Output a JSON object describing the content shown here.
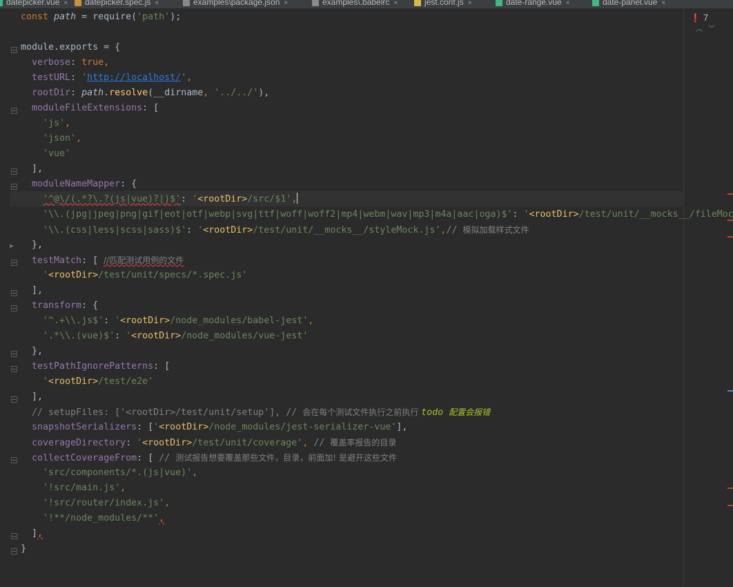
{
  "tabs": [
    {
      "label": "datepicker.vue",
      "icon": "vue-file-icon",
      "icon_color": "#41b883"
    },
    {
      "label": "datepicker.spec.js",
      "icon": "js-test-file-icon",
      "icon_color": "#c9913a"
    },
    {
      "label": "examples\\package.json",
      "icon": "json-file-icon",
      "icon_color": "#8a8a8a"
    },
    {
      "label": "examples\\.babelrc",
      "icon": "config-file-icon",
      "icon_color": "#8a8a8a"
    },
    {
      "label": "jest.conf.js",
      "icon": "js-file-icon",
      "icon_color": "#d8b74b"
    },
    {
      "label": "date-range.vue",
      "icon": "vue-file-icon",
      "icon_color": "#41b883"
    },
    {
      "label": "date-panel.vue",
      "icon": "vue-file-icon",
      "icon_color": "#41b883"
    }
  ],
  "inspection": {
    "error_count": "7"
  },
  "colors": {
    "background": "#2b2b2b",
    "keyword": "#cc7832",
    "property": "#9876aa",
    "string": "#6a8759",
    "tag": "#e8bf6a",
    "comment": "#808080",
    "todo": "#a8c023",
    "link": "#287bde"
  },
  "code_lines": [
    [
      {
        "t": "const ",
        "c": "kw"
      },
      {
        "t": "path",
        "c": "var"
      },
      {
        "t": " = require(",
        "c": ""
      },
      {
        "t": "'path'",
        "c": "str"
      },
      {
        "t": ");",
        "c": ""
      }
    ],
    [],
    [
      {
        "t": "module.exports = {",
        "c": ""
      }
    ],
    [
      {
        "t": "  ",
        "c": ""
      },
      {
        "t": "verbose",
        "c": "prop"
      },
      {
        "t": ": ",
        "c": ""
      },
      {
        "t": "true",
        "c": "kw"
      },
      {
        "t": ",",
        "c": "kw"
      }
    ],
    [
      {
        "t": "  ",
        "c": ""
      },
      {
        "t": "testURL",
        "c": "prop"
      },
      {
        "t": ": ",
        "c": ""
      },
      {
        "t": "'",
        "c": "str"
      },
      {
        "t": "http://localhost/",
        "c": "url"
      },
      {
        "t": "'",
        "c": "str"
      },
      {
        "t": ",",
        "c": "kw"
      }
    ],
    [
      {
        "t": "  ",
        "c": ""
      },
      {
        "t": "rootDir",
        "c": "prop"
      },
      {
        "t": ": ",
        "c": ""
      },
      {
        "t": "path",
        "c": "var"
      },
      {
        "t": ".",
        "c": ""
      },
      {
        "t": "resolve",
        "c": "fn"
      },
      {
        "t": "(__dirname",
        "c": ""
      },
      {
        "t": ", ",
        "c": "kw"
      },
      {
        "t": "'../../'",
        "c": "str"
      },
      {
        "t": "),",
        "c": ""
      }
    ],
    [
      {
        "t": "  ",
        "c": ""
      },
      {
        "t": "moduleFileExtensions",
        "c": "prop"
      },
      {
        "t": ": [",
        "c": ""
      }
    ],
    [
      {
        "t": "    ",
        "c": ""
      },
      {
        "t": "'js'",
        "c": "str"
      },
      {
        "t": ",",
        "c": "kw"
      }
    ],
    [
      {
        "t": "    ",
        "c": ""
      },
      {
        "t": "'json'",
        "c": "str"
      },
      {
        "t": ",",
        "c": "kw"
      }
    ],
    [
      {
        "t": "    ",
        "c": ""
      },
      {
        "t": "'vue'",
        "c": "str"
      }
    ],
    [
      {
        "t": "  ],",
        "c": ""
      }
    ],
    [
      {
        "t": "  ",
        "c": ""
      },
      {
        "t": "moduleNameMapper",
        "c": "prop"
      },
      {
        "t": ": {",
        "c": ""
      }
    ],
    [
      {
        "t": "    ",
        "c": ""
      },
      {
        "t": "'^@\\/(.*?\\.?(js|vue)?|)$'",
        "c": "str uline"
      },
      {
        "t": ": ",
        "c": ""
      },
      {
        "t": "'",
        "c": "str"
      },
      {
        "t": "<rootDir>",
        "c": "tag"
      },
      {
        "t": "/src/$1'",
        "c": "str"
      },
      {
        "t": ",",
        "c": "kw"
      }
    ],
    [
      {
        "t": "    ",
        "c": ""
      },
      {
        "t": "'\\\\.(jpg|jpeg|png|gif|eot|otf|webp|svg|ttf|woff|woff2|mp4|webm|wav|mp3|m4a|aac|oga)$'",
        "c": "str"
      },
      {
        "t": ": ",
        "c": ""
      },
      {
        "t": "'",
        "c": "str"
      },
      {
        "t": "<rootDir>",
        "c": "tag"
      },
      {
        "t": "/test/unit/__mocks__/fileMock.js'",
        "c": "str"
      }
    ],
    [
      {
        "t": "    ",
        "c": ""
      },
      {
        "t": "'\\\\.(css|less|scss|sass)$'",
        "c": "str"
      },
      {
        "t": ": ",
        "c": ""
      },
      {
        "t": "'",
        "c": "str"
      },
      {
        "t": "<rootDir>",
        "c": "tag"
      },
      {
        "t": "/test/unit/__mocks__/styleMock.js'",
        "c": "str"
      },
      {
        "t": ",",
        "c": "kw"
      },
      {
        "t": "// ",
        "c": "cmt"
      },
      {
        "t": "模拟加载样式文件",
        "c": "cmt cn"
      }
    ],
    [
      {
        "t": "  },",
        "c": ""
      }
    ],
    [
      {
        "t": "  ",
        "c": ""
      },
      {
        "t": "testMatch",
        "c": "prop"
      },
      {
        "t": ": [ ",
        "c": ""
      },
      {
        "t": "//匹配测试用例的文件",
        "c": "cmt cn uline"
      }
    ],
    [
      {
        "t": "    ",
        "c": ""
      },
      {
        "t": "'",
        "c": "str"
      },
      {
        "t": "<rootDir>",
        "c": "tag"
      },
      {
        "t": "/test/unit/specs/*.spec.js'",
        "c": "str"
      }
    ],
    [
      {
        "t": "  ],",
        "c": ""
      }
    ],
    [
      {
        "t": "  ",
        "c": ""
      },
      {
        "t": "transform",
        "c": "prop"
      },
      {
        "t": ": {",
        "c": ""
      }
    ],
    [
      {
        "t": "    ",
        "c": ""
      },
      {
        "t": "'^.+\\\\.js$'",
        "c": "str"
      },
      {
        "t": ": ",
        "c": ""
      },
      {
        "t": "'",
        "c": "str"
      },
      {
        "t": "<rootDir>",
        "c": "tag"
      },
      {
        "t": "/node_modules/babel-jest'",
        "c": "str"
      },
      {
        "t": ",",
        "c": "kw"
      }
    ],
    [
      {
        "t": "    ",
        "c": ""
      },
      {
        "t": "'.*\\\\.(vue)$'",
        "c": "str"
      },
      {
        "t": ": ",
        "c": ""
      },
      {
        "t": "'",
        "c": "str"
      },
      {
        "t": "<rootDir>",
        "c": "tag"
      },
      {
        "t": "/node_modules/vue-jest'",
        "c": "str"
      }
    ],
    [
      {
        "t": "  },",
        "c": ""
      }
    ],
    [
      {
        "t": "  ",
        "c": ""
      },
      {
        "t": "testPathIgnorePatterns",
        "c": "prop"
      },
      {
        "t": ": [",
        "c": ""
      }
    ],
    [
      {
        "t": "    ",
        "c": ""
      },
      {
        "t": "'",
        "c": "str"
      },
      {
        "t": "<rootDir>",
        "c": "tag"
      },
      {
        "t": "/test/e2e'",
        "c": "str"
      }
    ],
    [
      {
        "t": "  ],",
        "c": ""
      }
    ],
    [
      {
        "t": "  // setupFiles: ['<rootDir>/test/unit/setup'], // ",
        "c": "cmt"
      },
      {
        "t": "会在每个测试文件执行之前执行 ",
        "c": "cmt cn"
      },
      {
        "t": "todo ",
        "c": "todo"
      },
      {
        "t": "配置会报错",
        "c": "todo cn"
      }
    ],
    [
      {
        "t": "  ",
        "c": ""
      },
      {
        "t": "snapshotSerializers",
        "c": "prop"
      },
      {
        "t": ": [",
        "c": ""
      },
      {
        "t": "'",
        "c": "str"
      },
      {
        "t": "<rootDir>",
        "c": "tag"
      },
      {
        "t": "/node_modules/jest-serializer-vue'",
        "c": "str"
      },
      {
        "t": "],",
        "c": ""
      }
    ],
    [
      {
        "t": "  ",
        "c": ""
      },
      {
        "t": "coverageDirectory",
        "c": "prop"
      },
      {
        "t": ": ",
        "c": ""
      },
      {
        "t": "'",
        "c": "str"
      },
      {
        "t": "<rootDir>",
        "c": "tag"
      },
      {
        "t": "/test/unit/coverage'",
        "c": "str"
      },
      {
        "t": ", ",
        "c": "kw"
      },
      {
        "t": "// ",
        "c": "cmt"
      },
      {
        "t": "覆盖率报告的目录",
        "c": "cmt cn"
      }
    ],
    [
      {
        "t": "  ",
        "c": ""
      },
      {
        "t": "collectCoverageFrom",
        "c": "prop"
      },
      {
        "t": ": [ ",
        "c": ""
      },
      {
        "t": "// ",
        "c": "cmt"
      },
      {
        "t": "测试报告想要覆盖那些文件，目录，前面加! 是避开这些文件",
        "c": "cmt cn"
      }
    ],
    [
      {
        "t": "    ",
        "c": ""
      },
      {
        "t": "'src/components/*.(js|vue)'",
        "c": "str"
      },
      {
        "t": ",",
        "c": "kw"
      }
    ],
    [
      {
        "t": "    ",
        "c": ""
      },
      {
        "t": "'!src/main.js'",
        "c": "str"
      },
      {
        "t": ",",
        "c": "kw"
      }
    ],
    [
      {
        "t": "    ",
        "c": ""
      },
      {
        "t": "'!src/router/index.js'",
        "c": "str"
      },
      {
        "t": ",",
        "c": "kw"
      }
    ],
    [
      {
        "t": "    ",
        "c": ""
      },
      {
        "t": "'!**/node_modules/**'",
        "c": "str"
      },
      {
        "t": ",",
        "c": "kw uline"
      }
    ],
    [
      {
        "t": "  ]",
        "c": ""
      },
      {
        "t": ",",
        "c": "kw uline"
      }
    ],
    [
      {
        "t": "}",
        "c": ""
      }
    ]
  ]
}
